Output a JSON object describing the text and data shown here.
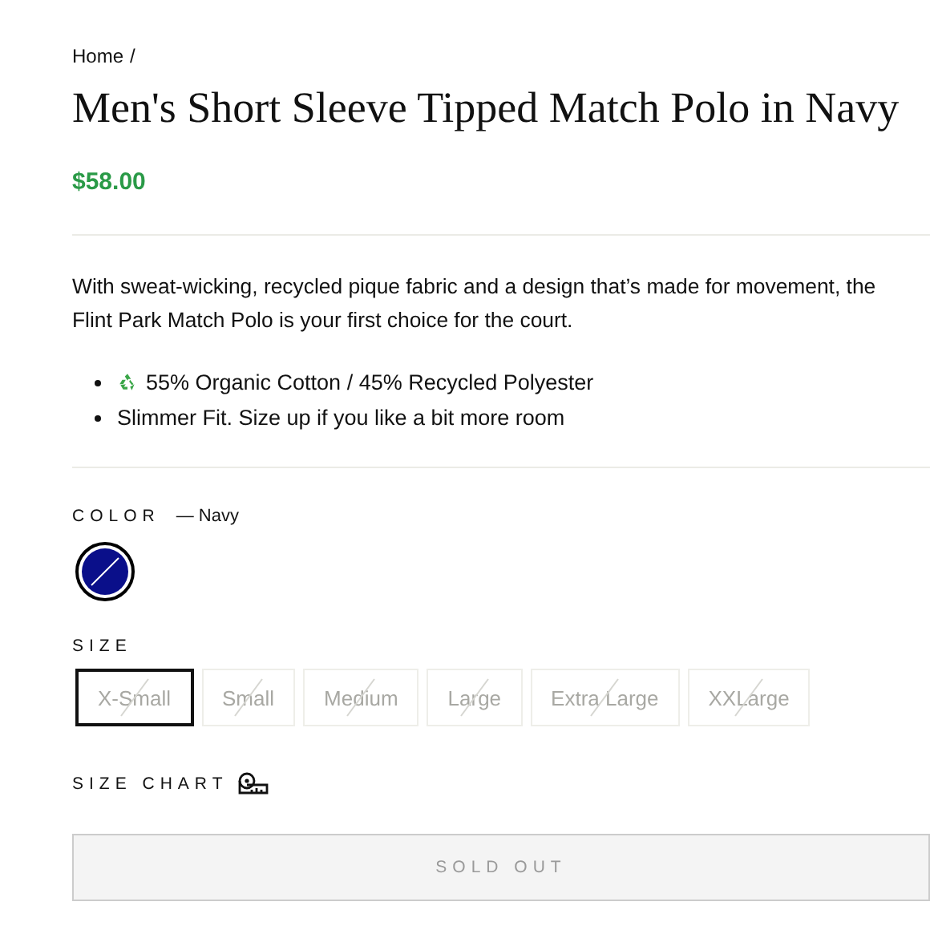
{
  "breadcrumb": {
    "home": "Home",
    "separator": "/"
  },
  "title": "Men's Short Sleeve Tipped Match Polo in Navy",
  "price": "$58.00",
  "description": "With sweat-wicking, recycled pique fabric and a design that’s made for movement, the Flint Park Match Polo is your first choice for the court.",
  "features": [
    {
      "text": "55% Organic Cotton / 45% Recycled Polyester",
      "recycle_icon": true
    },
    {
      "text": "Slimmer Fit.  Size up if you like a bit more room",
      "recycle_icon": false
    }
  ],
  "color": {
    "label": "COLOR",
    "value": "— Navy",
    "swatches": [
      {
        "color": "#0a0f8a",
        "selected": true,
        "available": false
      }
    ]
  },
  "size": {
    "label": "SIZE",
    "options": [
      {
        "label": "X-Small",
        "selected": true,
        "available": false
      },
      {
        "label": "Small",
        "selected": false,
        "available": false
      },
      {
        "label": "Medium",
        "selected": false,
        "available": false
      },
      {
        "label": "Large",
        "selected": false,
        "available": false
      },
      {
        "label": "Extra Large",
        "selected": false,
        "available": false
      },
      {
        "label": "XXLarge",
        "selected": false,
        "available": false
      }
    ]
  },
  "size_chart": "SIZE CHART",
  "button": {
    "label": "SOLD OUT",
    "disabled": true
  }
}
